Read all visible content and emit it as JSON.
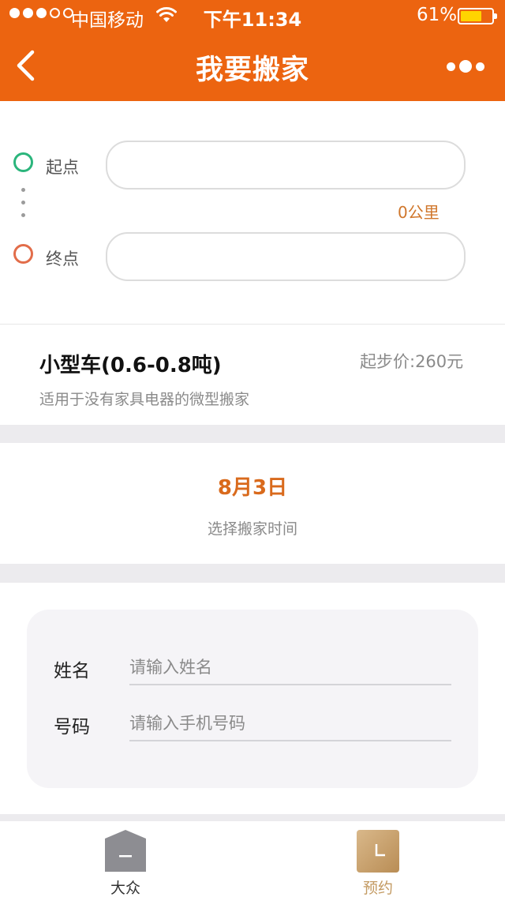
{
  "status_bar": {
    "carrier": "中国移动",
    "time": "下午11:34",
    "battery": "61%",
    "battery_level": 0.61
  },
  "nav": {
    "title": "我要搬家"
  },
  "route": {
    "start_label": "起点",
    "end_label": "终点",
    "start_value": "",
    "end_value": "",
    "distance": "0公里"
  },
  "vehicle": {
    "name": "小型车(0.6-0.8吨)",
    "price": "起步价:260元",
    "description": "适用于没有家具电器的微型搬家"
  },
  "date": {
    "value": "8月3日",
    "hint": "选择搬家时间"
  },
  "contact": {
    "name_label": "姓名",
    "name_placeholder": "请输入姓名",
    "phone_label": "号码",
    "phone_placeholder": "请输入手机号码"
  },
  "tabs": [
    {
      "label": "大众",
      "icon": "house-icon",
      "color": "#8d8d92"
    },
    {
      "label": "预约",
      "icon": "clock-icon",
      "color": "#c9a46f"
    }
  ],
  "colors": {
    "brand": "#ec6410",
    "start_ring": "#2bb57c",
    "end_ring": "#e26d4a",
    "accent_text": "#d96a1c"
  }
}
